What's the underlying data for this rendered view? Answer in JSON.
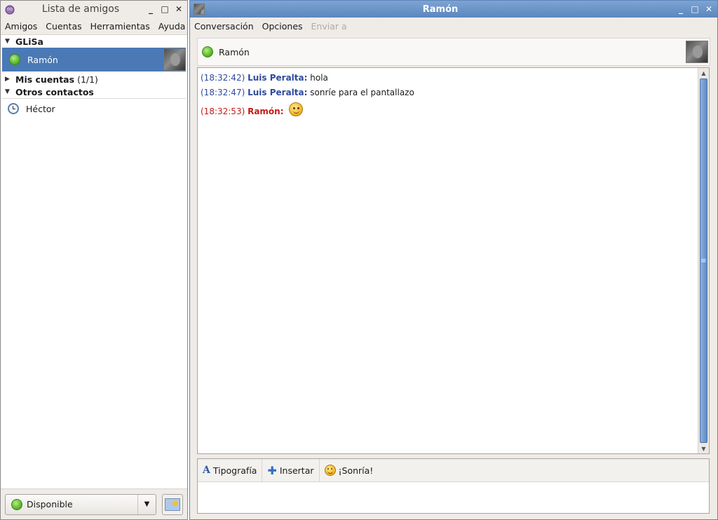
{
  "buddy_window": {
    "title": "Lista de amigos",
    "menu": [
      "Amigos",
      "Cuentas",
      "Herramientas",
      "Ayuda"
    ],
    "groups": [
      {
        "name": "GLiSa",
        "expanded": true
      },
      {
        "name": "Mis cuentas",
        "count": "(1/1)",
        "expanded": false
      },
      {
        "name": "Otros contactos",
        "expanded": true
      }
    ],
    "buddies": {
      "selected": "Ramón",
      "other": "Héctor"
    },
    "status_selector": {
      "value": "Disponible"
    }
  },
  "chat_window": {
    "title": "Ramón",
    "menu": [
      "Conversación",
      "Opciones",
      "Enviar a"
    ],
    "header_name": "Ramón",
    "messages": [
      {
        "time": "(18:32:42)",
        "sender": "Luis Peralta:",
        "text": "hola"
      },
      {
        "time": "(18:32:47)",
        "sender": "Luis Peralta:",
        "text": "sonríe para el pantallazo"
      },
      {
        "time": "(18:32:53)",
        "sender": "Ramón:",
        "text": ""
      }
    ],
    "toolbar": {
      "font_label": "Tipografía",
      "insert_label": "Insertar",
      "smile_label": "¡Sonría!"
    }
  },
  "colors": {
    "selection": "#4a79b5",
    "remote_name": "#2e4a9e",
    "local_name": "#c61818",
    "status_available": "#5cb82b"
  },
  "icons": [
    "pidgin-icon",
    "minimize-icon",
    "maximize-icon",
    "close-icon",
    "available-status-icon",
    "away-clock-icon",
    "smiley-icon",
    "font-icon",
    "insert-plus-icon",
    "buddy-pounce-icon",
    "dropdown-arrow-icon"
  ]
}
